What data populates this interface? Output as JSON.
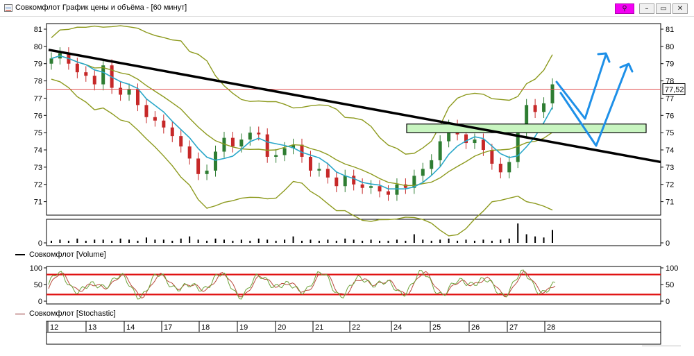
{
  "window": {
    "title": "Совкомфлот График цены и объёма - [60 минут]",
    "buttons": {
      "pin": "⚲",
      "minimize": "–",
      "maximize": "▭",
      "close": "✕"
    }
  },
  "legends": {
    "volume": "Совкомфлот [Volume]",
    "stochastic": "Совкомфлот [Stochastic]"
  },
  "colors": {
    "candle_up": "#2e7d32",
    "candle_down": "#c62828",
    "bollinger": "#8d9a1e",
    "ma": "#29a7c9",
    "trendline": "#000000",
    "current_price_line": "#e05050",
    "zone_fill": "#c8f5c0",
    "stoch_k": "#6da33a",
    "stoch_d": "#b8483a",
    "stoch_levels": "#e01010",
    "annotation_arrows": "#1e90e8"
  },
  "chart_data": [
    {
      "type": "line",
      "panel": "price",
      "y_ticks": [
        "81",
        "80",
        "79",
        "78",
        "77",
        "76",
        "75",
        "74",
        "73",
        "72",
        "71"
      ],
      "ylim": [
        70.3,
        81
      ],
      "current_price": 77.52,
      "current_price_label": "77,52",
      "x_tick_labels": [
        "12",
        "13",
        "14",
        "17",
        "18",
        "19",
        "20",
        "21",
        "22",
        "24",
        "25",
        "26",
        "27",
        "28"
      ],
      "close_series": [
        79.3,
        79.6,
        79.0,
        78.5,
        78.3,
        77.8,
        78.9,
        77.6,
        77.2,
        77.5,
        76.6,
        75.9,
        75.7,
        75.3,
        74.8,
        74.2,
        73.5,
        72.6,
        72.8,
        73.9,
        74.7,
        74.2,
        74.6,
        75.0,
        74.9,
        73.6,
        73.7,
        74.1,
        74.3,
        73.6,
        72.8,
        72.9,
        72.4,
        71.9,
        72.5,
        72.0,
        71.8,
        71.9,
        71.6,
        71.4,
        72.0,
        71.8,
        72.5,
        72.9,
        73.4,
        74.5,
        75.4,
        74.9,
        74.4,
        74.6,
        74.0,
        73.2,
        72.7,
        73.3,
        75.1,
        76.6,
        76.2,
        76.7,
        77.8
      ],
      "up_flags": [
        true,
        true,
        false,
        false,
        false,
        false,
        true,
        false,
        false,
        true,
        false,
        false,
        false,
        false,
        false,
        false,
        false,
        false,
        true,
        true,
        true,
        false,
        true,
        true,
        false,
        false,
        true,
        true,
        true,
        false,
        false,
        true,
        false,
        false,
        true,
        false,
        false,
        true,
        false,
        false,
        true,
        false,
        true,
        true,
        true,
        true,
        true,
        false,
        false,
        true,
        false,
        false,
        false,
        true,
        true,
        true,
        false,
        true,
        true
      ],
      "trendline_start": [
        79.8,
        0
      ],
      "trendline_end": [
        73.3,
        1
      ],
      "horizontal_zone": [
        75.0,
        75.5
      ]
    },
    {
      "type": "bar",
      "panel": "volume",
      "y_ticks": [
        "0"
      ],
      "values": [
        2,
        3,
        2,
        4,
        2,
        3,
        3,
        2,
        4,
        3,
        2,
        5,
        3,
        3,
        2,
        4,
        6,
        3,
        2,
        4,
        3,
        2,
        3,
        2,
        4,
        3,
        2,
        3,
        6,
        2,
        3,
        2,
        3,
        2,
        4,
        3,
        2,
        3,
        2,
        2,
        3,
        2,
        8,
        3,
        2,
        3,
        4,
        2,
        3,
        2,
        3,
        2,
        3,
        4,
        18,
        8,
        6,
        5,
        12
      ]
    },
    {
      "type": "line",
      "panel": "stochastic",
      "y_ticks": [
        "100",
        "50",
        "0"
      ],
      "ylim": [
        0,
        100
      ],
      "levels": [
        80,
        20
      ]
    }
  ]
}
